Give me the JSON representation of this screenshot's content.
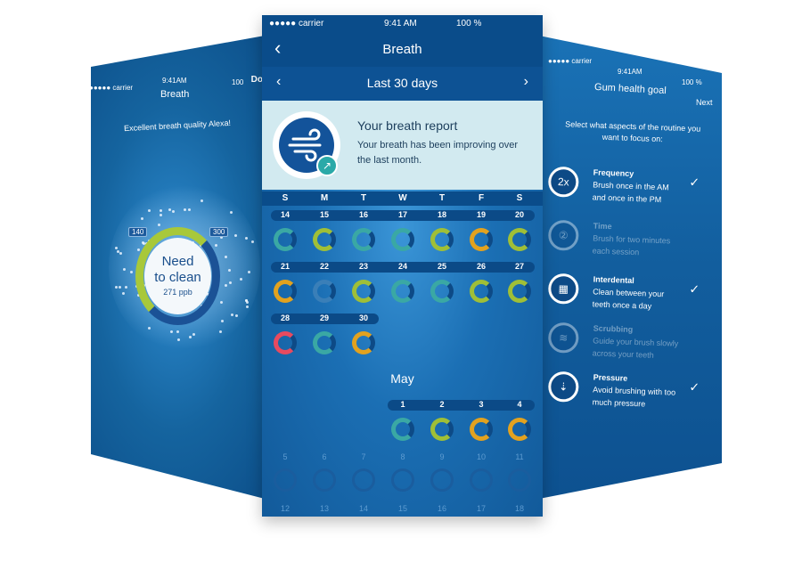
{
  "left_phone": {
    "status": {
      "carrier": "●●●●● carrier",
      "time": "9:41AM",
      "battery": "100"
    },
    "nav_title": "Breath",
    "nav_done": "Do",
    "quality_text": "Excellent breath quality Alexa!",
    "gauge": {
      "line1": "Need",
      "line2": "to clean",
      "value": "271 ppb",
      "min_tag": "140",
      "max_tag": "300"
    }
  },
  "center_phone": {
    "status": {
      "carrier": "●●●●● carrier",
      "time": "9:41 AM",
      "battery": "100 %"
    },
    "nav_title": "Breath",
    "range_label": "Last 30 days",
    "report": {
      "title": "Your breath report",
      "description": "Your breath has been improving over the last month."
    },
    "weekdays": [
      "S",
      "M",
      "T",
      "W",
      "T",
      "F",
      "S"
    ],
    "weeks": [
      [
        {
          "d": "14",
          "c": "#3aa8a4"
        },
        {
          "d": "15",
          "c": "#9fbf37"
        },
        {
          "d": "16",
          "c": "#3aa8a4"
        },
        {
          "d": "17",
          "c": "#3aa8a4"
        },
        {
          "d": "18",
          "c": "#9fbf37"
        },
        {
          "d": "19",
          "c": "#e2a21f"
        },
        {
          "d": "20",
          "c": "#9fbf37"
        }
      ],
      [
        {
          "d": "21",
          "c": "#e2a21f"
        },
        {
          "d": "22",
          "c": "#3a7fb8"
        },
        {
          "d": "23",
          "c": "#9fbf37"
        },
        {
          "d": "24",
          "c": "#3aa8a4"
        },
        {
          "d": "25",
          "c": "#3aa8a4"
        },
        {
          "d": "26",
          "c": "#9fbf37"
        },
        {
          "d": "27",
          "c": "#9fbf37"
        }
      ],
      [
        {
          "d": "28",
          "c": "#e84a5f"
        },
        {
          "d": "29",
          "c": "#3aa8a4"
        },
        {
          "d": "30",
          "c": "#e2a21f"
        }
      ]
    ],
    "month": "May",
    "may_days": [
      {
        "d": "1",
        "c": "#3aa8a4"
      },
      {
        "d": "2",
        "c": "#9fbf37"
      },
      {
        "d": "3",
        "c": "#e2a21f"
      },
      {
        "d": "4",
        "c": "#e2a21f"
      }
    ],
    "faded_top": [
      "5",
      "6",
      "7",
      "8",
      "9",
      "10",
      "11"
    ],
    "faded_bottom": [
      "12",
      "13",
      "14",
      "15",
      "16",
      "17",
      "18"
    ]
  },
  "right_phone": {
    "status": {
      "carrier": "●●●●● carrier",
      "time": "9:41AM",
      "battery": "100 %"
    },
    "nav_title": "Gum health goal",
    "nav_next": "Next",
    "intro": "Select what aspects of the routine you want to focus on:",
    "goals": [
      {
        "title": "Frequency",
        "desc": "Brush once in the AM and once in the PM",
        "icon": "2x",
        "checked": true,
        "dim": false
      },
      {
        "title": "Time",
        "desc": "Brush for two minutes each session",
        "icon": "②",
        "checked": false,
        "dim": true
      },
      {
        "title": "Interdental",
        "desc": "Clean between your teeth once a day",
        "icon": "▦",
        "checked": true,
        "dim": false
      },
      {
        "title": "Scrubbing",
        "desc": "Guide your brush slowly across your teeth",
        "icon": "≋",
        "checked": false,
        "dim": true
      },
      {
        "title": "Pressure",
        "desc": "Avoid brushing with too much pressure",
        "icon": "⇣",
        "checked": true,
        "dim": false
      }
    ],
    "check_mark": "✓"
  },
  "icons": {
    "back": "‹",
    "prev": "‹",
    "next": "›",
    "arrow": "↗"
  }
}
